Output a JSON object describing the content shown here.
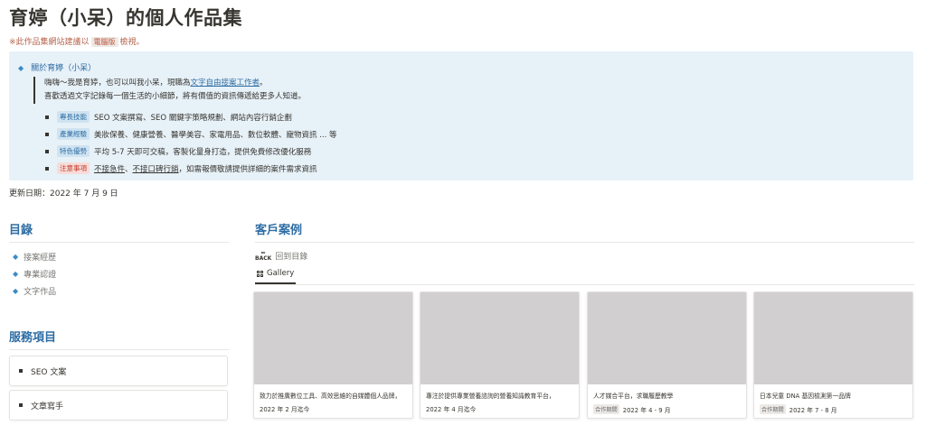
{
  "header": {
    "title": "育婷（小呆）的個人作品集",
    "note_prefix": "※此作品集網站建議以",
    "note_code": "電腦版",
    "note_suffix": "檢視。"
  },
  "about": {
    "heading": "關於育婷（小呆）",
    "quote_line1_a": "嗨嗨～我是育婷，也可以叫我小呆，現職為",
    "quote_line1_link": "文字自由接案工作者",
    "quote_line1_b": "。",
    "quote_line2": "喜歡透過文字記錄每一個生活的小細節，將有價值的資訊傳遞給更多人知道。",
    "items": [
      {
        "tag": "專長技能",
        "tag_color": "#cfe3f1",
        "text": "SEO 文案撰寫、SEO 關鍵字策略規劃、網站內容行銷企劃"
      },
      {
        "tag": "產業經驗",
        "tag_color": "#cfe3f1",
        "text": "美妝保養、健康營養、醫學美容、家電用品、數位軟體、寵物資訊 ... 等"
      },
      {
        "tag": "特色優勢",
        "tag_color": "#cfe3f1",
        "text": "平均 5-7 天即可交稿，客製化量身打造，提供免費修改優化服務"
      },
      {
        "tag": "注意事項",
        "tag_color": "#f7dcd8",
        "text_u1": "不接急件",
        "text_sep": "、",
        "text_u2": "不接口碑行銷",
        "text_rest": "，如需報價敬請提供詳細的案件需求資訊"
      }
    ]
  },
  "updated": "更新日期：2022 年 7 月 9 日",
  "toc": {
    "title": "目錄",
    "items": [
      "接案經歷",
      "專業認證",
      "文字作品"
    ]
  },
  "services": {
    "title": "服務項目",
    "items": [
      "SEO 文案",
      "文章寫手"
    ]
  },
  "cases": {
    "title": "客戶案例",
    "back_label": "回到目錄",
    "back_icon": "BACK",
    "tab_label": "Gallery",
    "cards": [
      {
        "title": "致力於推廣數位工具、高效思維的自媒體個人品牌，",
        "tag": "",
        "date": "2022 年 2 月迄今"
      },
      {
        "title": "專注於提供專業營養諮詢的營養知識教育平台，",
        "tag": "",
        "date": "2022 年 4 月迄今"
      },
      {
        "title": "人才媒合平台，求職履歷教學",
        "tag": "合作期間",
        "date": "2022 年 4 - 9 月"
      },
      {
        "title": "日本兒童 DNA 基因檢測第一品牌",
        "tag": "合作期間",
        "date": "2022 年 7 - 8 月"
      }
    ]
  },
  "colors": {
    "accent": "#2e6da4",
    "callout_bg": "#e7f1f8",
    "thumb": "#d1cfcf"
  }
}
